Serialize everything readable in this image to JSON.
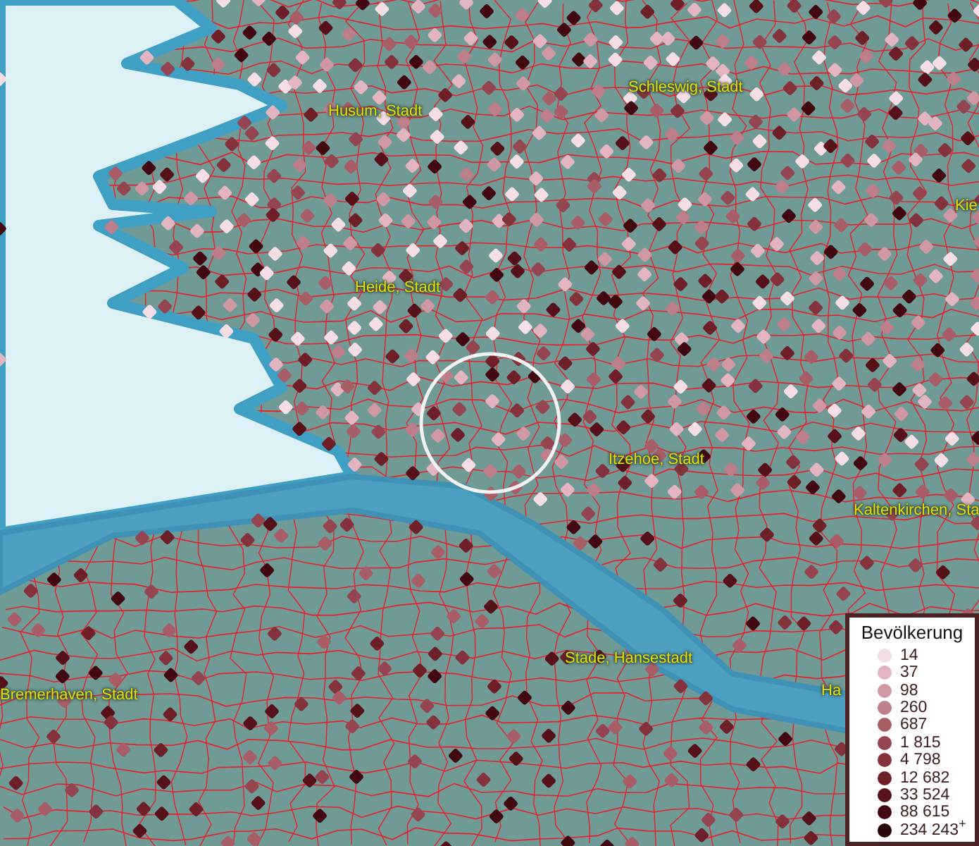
{
  "map": {
    "place_labels": [
      "Husum, Stadt",
      "Schleswig, Stadt",
      "Kie",
      "Heide, Stadt",
      "Itzehoe, Stadt",
      "Kaltenkirchen, Sta",
      "Stade, Hansestadt",
      "Bremerhaven, Stadt",
      "Ha"
    ]
  },
  "legend": {
    "title": "Bevölkerung",
    "entries": [
      {
        "label": "14",
        "color": "#f5dde5"
      },
      {
        "label": "37",
        "color": "#e2b5c0"
      },
      {
        "label": "98",
        "color": "#cf98a3"
      },
      {
        "label": "260",
        "color": "#bd7f8a"
      },
      {
        "label": "687",
        "color": "#a95d67"
      },
      {
        "label": "1 815",
        "color": "#944550"
      },
      {
        "label": "4 798",
        "color": "#84323c"
      },
      {
        "label": "12 682",
        "color": "#6f1f28"
      },
      {
        "label": "33 524",
        "color": "#561218"
      },
      {
        "label": "88 615",
        "color": "#420a10"
      },
      {
        "label": "234 243$^{+}$",
        "color": "#2a0508"
      }
    ]
  }
}
